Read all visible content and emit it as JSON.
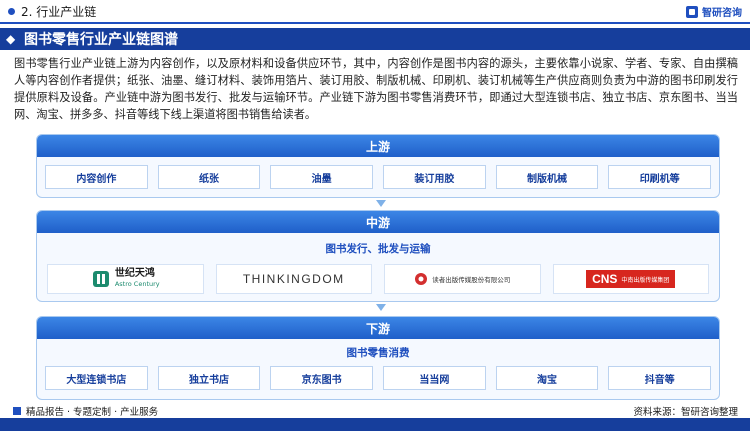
{
  "header": {
    "section": "2. 行业产业链",
    "brand": "智研咨询"
  },
  "title": "图书零售行业产业链图谱",
  "intro": "图书零售行业产业链上游为内容创作，以及原材料和设备供应环节，其中，内容创作是图书内容的源头，主要依靠小说家、学者、专家、自由撰稿人等内容创作者提供；纸张、油墨、缝订材料、装饰用箔片、装订用胶、制版机械、印刷机、装订机械等生产供应商则负责为中游的图书印刷发行提供原料及设备。产业链中游为图书发行、批发与运输环节。产业链下游为图书零售消费环节，即通过大型连锁书店、独立书店、京东图书、当当网、淘宝、拼多多、抖音等线下线上渠道将图书销售给读者。",
  "upstream": {
    "label": "上游",
    "items": [
      "内容创作",
      "纸张",
      "油墨",
      "装订用胶",
      "制版机械",
      "印刷机等"
    ]
  },
  "midstream": {
    "label": "中游",
    "subtitle": "图书发行、批发与运输",
    "logos": [
      {
        "name": "世纪天鸿",
        "sub": "Astro Century"
      },
      {
        "name": "THINKINGDOM"
      },
      {
        "name": "读者出版传媒股份有限公司"
      },
      {
        "name": "CNS",
        "sub": "中南出版传媒集团"
      }
    ]
  },
  "downstream": {
    "label": "下游",
    "subtitle": "图书零售消费",
    "items": [
      "大型连锁书店",
      "独立书店",
      "京东图书",
      "当当网",
      "淘宝",
      "抖音等"
    ]
  },
  "footer": {
    "left": "精品报告 · 专题定制 · 产业服务",
    "right": "资料来源：智研咨询整理"
  },
  "colors": {
    "primary": "#163e9c",
    "accent": "#1f4fbf",
    "tier_head": "#2a6fd6"
  }
}
